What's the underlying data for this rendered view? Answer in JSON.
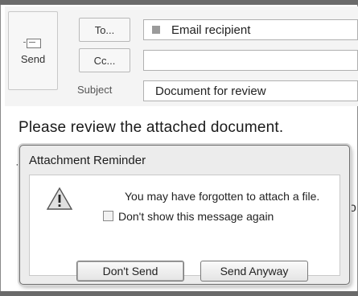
{
  "header": {
    "send_label": "Send",
    "to_label": "To...",
    "cc_label": "Cc...",
    "subject_label": "Subject",
    "to_value": "Email recipient",
    "cc_value": "",
    "subject_value": "Document for review"
  },
  "body": {
    "text": "Please review the attached document.",
    "fragment_a": "-",
    "fragment_b": "o"
  },
  "dialog": {
    "title": "Attachment Reminder",
    "message": "You may have forgotten to attach a file.",
    "checkbox_label": "Don't show this message again",
    "checkbox_checked": false,
    "buttons": {
      "dont_send": "Don't Send",
      "send_anyway": "Send Anyway"
    }
  },
  "icons": {
    "send": "send-envelope-icon",
    "recipient": "recipient-chip-icon",
    "warning": "warning-triangle-icon"
  },
  "colors": {
    "dialog_bg": "#ececec",
    "header_bg": "#f4f4f4",
    "warning_fill": "#e0e0e0"
  }
}
